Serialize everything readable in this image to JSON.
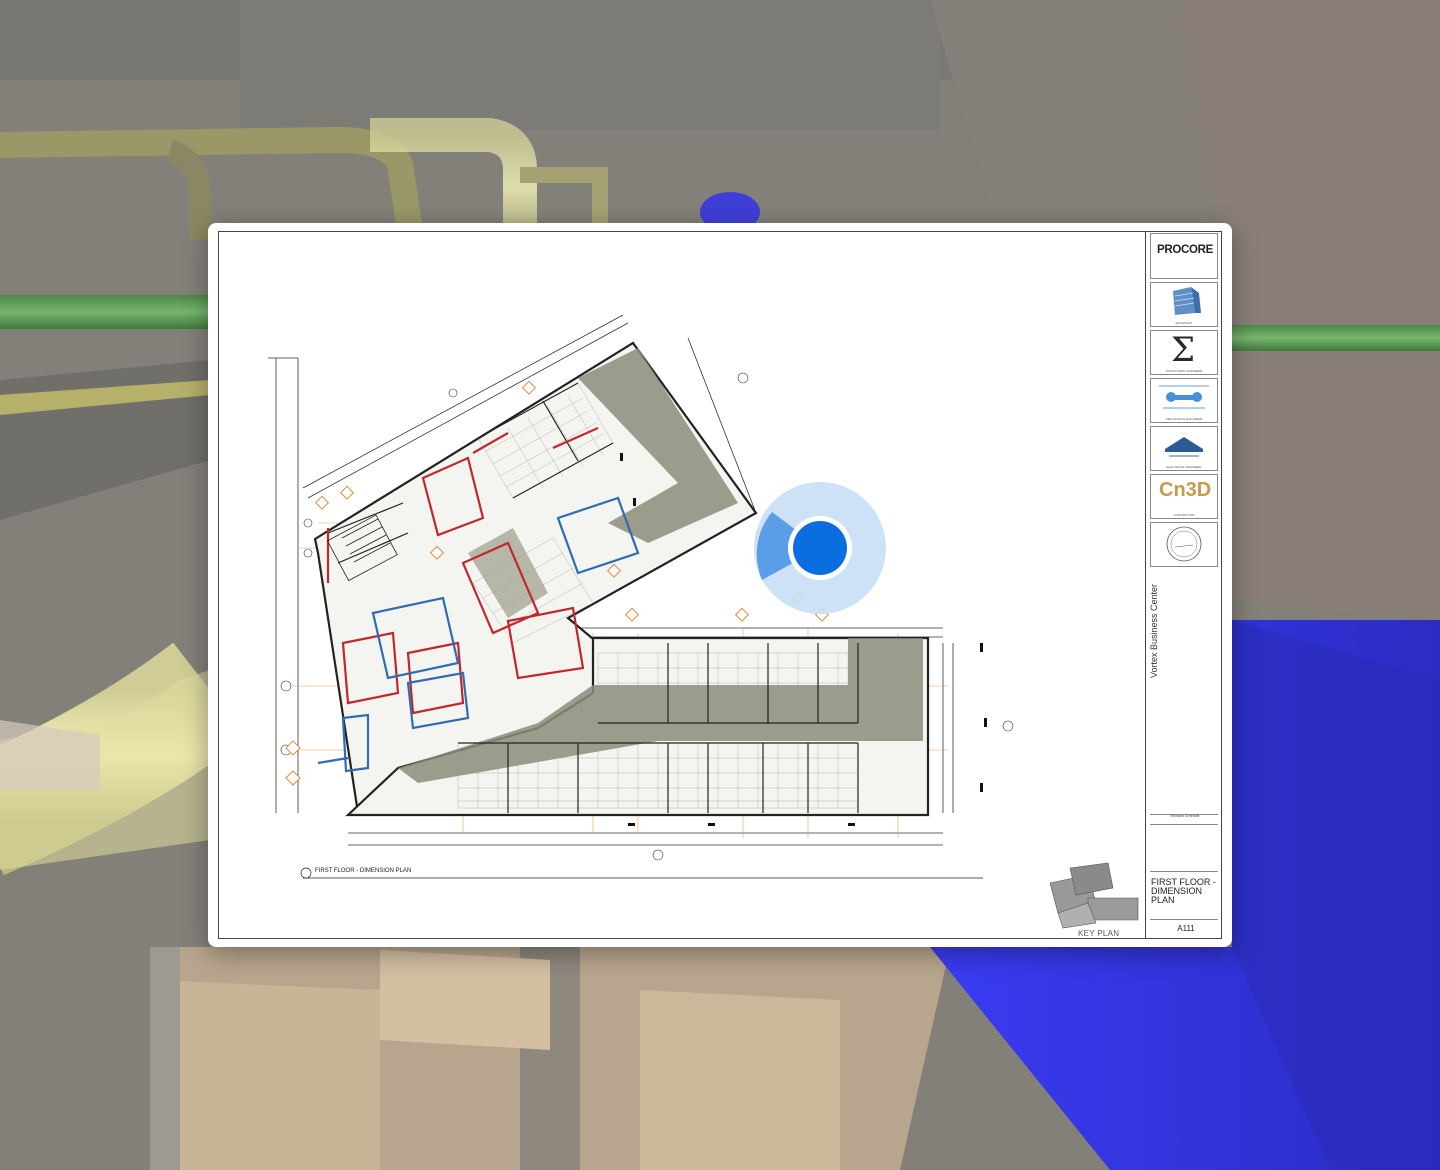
{
  "sheet": {
    "company_logo": "PROCORE",
    "consultant_captions": [
      "ARCHITECT",
      "STRUCTURAL ENGINEER",
      "MECHANICAL ENGINEER",
      "ELECTRICAL ENGINEER",
      "CONTRACTOR"
    ],
    "contractor_logo": "Cn3D",
    "structural_logo": "Σ",
    "project_name": "Vortex Business Center",
    "revision_label": "Revision Schedule",
    "sheet_name": "FIRST FLOOR - DIMENSION PLAN",
    "sheet_number": "A111",
    "plan_title": "FIRST FLOOR - DIMENSION PLAN",
    "plan_number": "1",
    "key_plan_label": "KEY PLAN"
  },
  "colors": {
    "location_dot": "#0a6ee0",
    "location_halo": "#c9dff6",
    "location_beam": "#5a9ee8",
    "background_pipe_yellow": "#f2efb0",
    "background_pipe_green": "#5c9a56",
    "background_duct_blue": "#3a3cf0",
    "corridor_fill": "#8c8c7a",
    "wall_red": "#c0282d",
    "wall_blue": "#2f6cb0"
  },
  "icons": {
    "location": "location-dot-icon",
    "heading": "heading-beam-icon"
  }
}
